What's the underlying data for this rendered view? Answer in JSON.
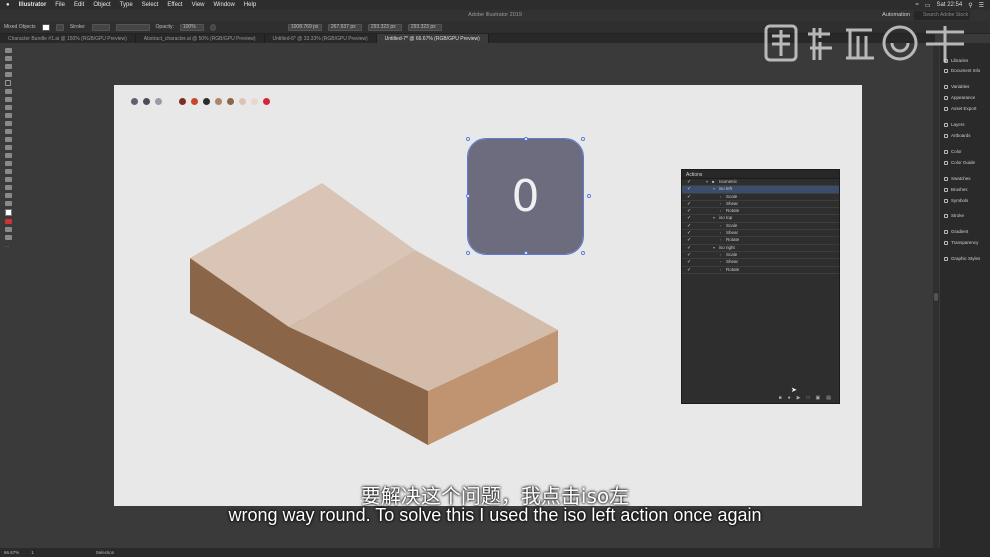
{
  "menubar": {
    "apple": "",
    "app": "Illustrator",
    "items": [
      "File",
      "Edit",
      "Object",
      "Type",
      "Select",
      "Effect",
      "View",
      "Window",
      "Help"
    ],
    "clock": "Sat 22:54"
  },
  "titlebar": {
    "title": "Adobe Illustrator 2019",
    "workspace": "Automation",
    "search_placeholder": "Search Adobe Stock"
  },
  "controlbar": {
    "selection_label": "Mixed Objects",
    "stroke_label": "Stroke:",
    "opacity_label": "Opacity:",
    "opacity_value": "100%",
    "x_value": "1008.769 px",
    "y_value": "267.637 px",
    "w_value": "293.323 px",
    "h_value": "293.323 px"
  },
  "tabs": [
    {
      "label": "Character Bundle #1.ai @ 150% (RGB/GPU Preview)",
      "active": false
    },
    {
      "label": "Abstract_character.ai @ 50% (RGB/GPU Preview)",
      "active": false
    },
    {
      "label": "Untitled-6* @ 33.33% (RGB/GPU Preview)",
      "active": false
    },
    {
      "label": "Untitled-7* @ 66.67% (RGB/GPU Preview)",
      "active": true
    }
  ],
  "swatches": [
    "#625f74",
    "#4e4c5a",
    "#9b9ba8",
    "#e8e8e8",
    "#7a2e24",
    "#c8452e",
    "#2b2b2b",
    "#b08363",
    "#8a6548",
    "#dbc4b4",
    "#e9d7cd",
    "#d6243c"
  ],
  "artwork": {
    "square_text": "0",
    "square_color": "#6d6b7e",
    "top_light": "#d9c4b6",
    "top_mid": "#d4bcab",
    "side_left": "#8a6548",
    "side_right": "#c09470"
  },
  "actions_panel": {
    "title": "Actions",
    "rows": [
      {
        "indent": 0,
        "type": "set",
        "label": "Isometric",
        "highlight": false
      },
      {
        "indent": 1,
        "type": "action",
        "label": "iso left",
        "highlight": true
      },
      {
        "indent": 2,
        "type": "step",
        "label": "Scale",
        "highlight": false
      },
      {
        "indent": 2,
        "type": "step",
        "label": "Shear",
        "highlight": false
      },
      {
        "indent": 2,
        "type": "step",
        "label": "Rotate",
        "highlight": false
      },
      {
        "indent": 1,
        "type": "action",
        "label": "iso top",
        "highlight": false
      },
      {
        "indent": 2,
        "type": "step",
        "label": "Scale",
        "highlight": false
      },
      {
        "indent": 2,
        "type": "step",
        "label": "Shear",
        "highlight": false
      },
      {
        "indent": 2,
        "type": "step",
        "label": "Rotate",
        "highlight": false
      },
      {
        "indent": 1,
        "type": "action",
        "label": "iso right",
        "highlight": false
      },
      {
        "indent": 2,
        "type": "step",
        "label": "Scale",
        "highlight": false
      },
      {
        "indent": 2,
        "type": "step",
        "label": "Shear",
        "highlight": false
      },
      {
        "indent": 2,
        "type": "step",
        "label": "Rotate",
        "highlight": false
      }
    ]
  },
  "right_panel": {
    "items": [
      "Libraries",
      "Document Info",
      "Variables",
      "Appearance",
      "Asset Export",
      "Layers",
      "Artboards",
      "Color",
      "Color Guide",
      "Swatches",
      "Brushes",
      "Symbols",
      "Stroke",
      "Gradient",
      "Transparency",
      "Graphic Styles"
    ]
  },
  "statusbar": {
    "zoom": "66.67%",
    "artboard": "1",
    "tool": "Selection"
  },
  "subtitles": {
    "cn": "要解决这个问题，我点击iso左",
    "en": "wrong way round. To solve this I used the iso left action once again"
  }
}
